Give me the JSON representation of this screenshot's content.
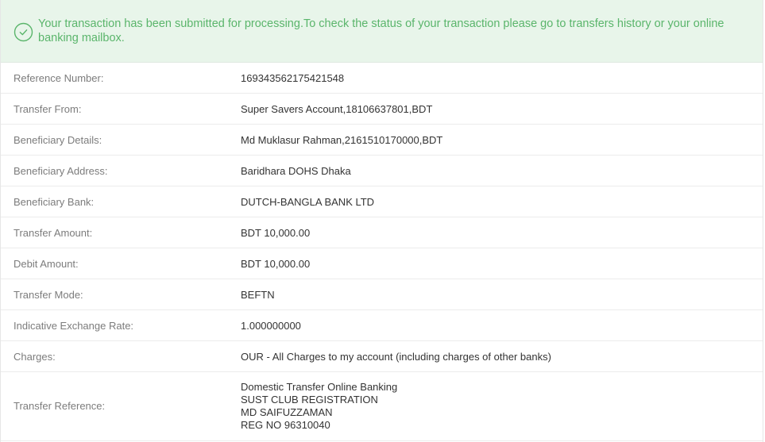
{
  "alert": {
    "icon": "check-circle-icon",
    "message": "Your transaction has been submitted for processing.To check the status of your transaction please go to transfers history or your online banking mailbox.",
    "color": "#5ab56b",
    "background": "#e8f5ea"
  },
  "details": [
    {
      "label": "Reference Number:",
      "value": "169343562175421548"
    },
    {
      "label": "Transfer From:",
      "value": "Super Savers Account,18106637801,BDT"
    },
    {
      "label": "Beneficiary Details:",
      "value": "Md Muklasur Rahman,2161510170000,BDT"
    },
    {
      "label": "Beneficiary Address:",
      "value": "Baridhara DOHS Dhaka"
    },
    {
      "label": "Beneficiary Bank:",
      "value": "DUTCH-BANGLA BANK LTD"
    },
    {
      "label": "Transfer Amount:",
      "value": "BDT 10,000.00"
    },
    {
      "label": "Debit Amount:",
      "value": "BDT 10,000.00"
    },
    {
      "label": "Transfer Mode:",
      "value": "BEFTN"
    },
    {
      "label": "Indicative Exchange Rate:",
      "value": "1.000000000"
    },
    {
      "label": "Charges:",
      "value": "OUR - All Charges to my account (including charges of other banks)"
    }
  ],
  "transfer_reference": {
    "label": "Transfer Reference:",
    "lines": [
      "Domestic Transfer Online Banking",
      "SUST CLUB REGISTRATION",
      "MD SAIFUZZAMAN",
      "REG NO 96310040"
    ]
  }
}
